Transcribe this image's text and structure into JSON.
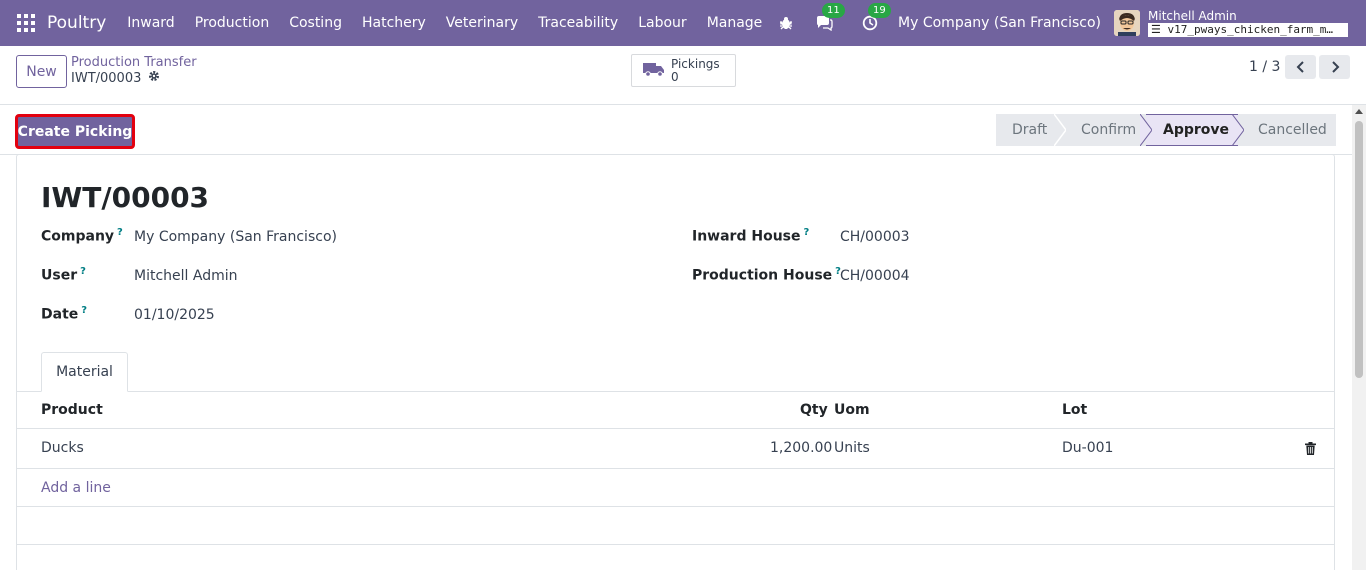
{
  "navbar": {
    "brand": "Poultry",
    "menu": [
      "Inward",
      "Production",
      "Costing",
      "Hatchery",
      "Veterinary",
      "Traceability",
      "Labour",
      "Manage"
    ],
    "messages_count": "11",
    "activities_count": "19",
    "company": "My Company (San Francisco)",
    "user_name": "Mitchell Admin",
    "database": "v17_pways_chicken_farm_m…",
    "color": "#71639e"
  },
  "control": {
    "new_label": "New",
    "breadcrumb_parent": "Production Transfer",
    "breadcrumb_current": "IWT/00003",
    "smart_button_label": "Pickings",
    "smart_button_value": "0",
    "pager": "1 / 3"
  },
  "status": {
    "create_button": "Create Picking",
    "stages": [
      "Draft",
      "Confirm",
      "Approve",
      "Cancelled"
    ],
    "active_stage": "Approve"
  },
  "record": {
    "title": "IWT/00003",
    "fields": {
      "company_label": "Company",
      "company_value": "My Company (San Francisco)",
      "user_label": "User",
      "user_value": "Mitchell Admin",
      "date_label": "Date",
      "date_value": "01/10/2025",
      "inward_house_label": "Inward House",
      "inward_house_value": "CH/00003",
      "production_house_label": "Production House",
      "production_house_value": "CH/00004"
    },
    "help_mark": "?"
  },
  "material": {
    "tab_label": "Material",
    "columns": [
      "Product",
      "Qty",
      "Uom",
      "Lot"
    ],
    "rows": [
      {
        "product": "Ducks",
        "qty": "1,200.00",
        "uom": "Units",
        "lot": "Du-001"
      }
    ],
    "add_line": "Add a line"
  }
}
